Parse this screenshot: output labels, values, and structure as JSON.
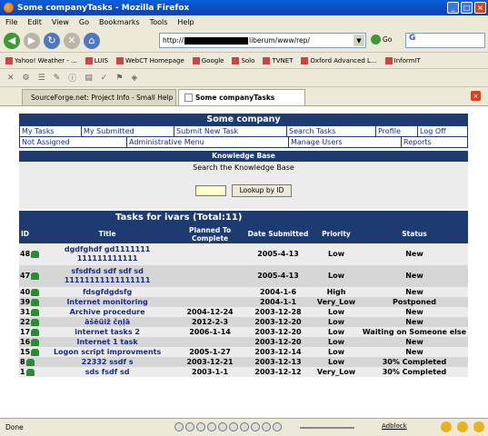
{
  "window": {
    "title": "Some companyTasks - Mozilla Firefox"
  },
  "menubar": [
    "File",
    "Edit",
    "View",
    "Go",
    "Bookmarks",
    "Tools",
    "Help"
  ],
  "navbar": {
    "url_prefix": "http://",
    "url_suffix": "liberum/www/rep/",
    "go_label": "Go",
    "search_value": "G"
  },
  "bookmarks": [
    "Yahoo! Weather - ...",
    "LUIS",
    "WebCT Homepage",
    "Google",
    "Solo",
    "TVNET",
    "Oxford Advanced L...",
    "InformIT"
  ],
  "tabs": [
    {
      "label": "SourceForge.net: Project Info - Small Help ..."
    },
    {
      "label": "Some companyTasks"
    }
  ],
  "app": {
    "company": "Some company",
    "menu_row1": [
      "My Tasks",
      "My Submitted",
      "Submit New Task",
      "Search Tasks",
      "Profile",
      "Log Off"
    ],
    "menu_row2": [
      "Not Assigned",
      "Administrative Menu",
      "Manage Users",
      "Reports"
    ],
    "kb_title": "Knowledge Base",
    "kb_label": "Search the Knowledge Base",
    "kb_input_value": "",
    "kb_button": "Lookup by ID",
    "tasks_title": "Tasks for ivars (Total:11)",
    "columns": [
      "ID",
      "Title",
      "Planned To Complete",
      "Date Submitted",
      "Priority",
      "Status"
    ],
    "rows": [
      {
        "id": "48",
        "title": "dgdfghdf gd1111111 111111111111",
        "planned": "",
        "submitted": "2005-4-13",
        "priority": "Low",
        "status": "New"
      },
      {
        "id": "47",
        "title": "sfsdfsd sdf sdf sd 11111111111111111",
        "planned": "",
        "submitted": "2005-4-13",
        "priority": "Low",
        "status": "New"
      },
      {
        "id": "40",
        "title": "fdsgfdgdsfg",
        "planned": "",
        "submitted": "2004-1-6",
        "priority": "High",
        "status": "New"
      },
      {
        "id": "39",
        "title": "Internet monitoring",
        "planned": "",
        "submitted": "2004-1-1",
        "priority": "Very_Low",
        "status": "Postponed"
      },
      {
        "id": "31",
        "title": "Archive procedure",
        "planned": "2004-12-24",
        "submitted": "2003-12-28",
        "priority": "Low",
        "status": "New"
      },
      {
        "id": "22",
        "title": "āšēūiž čņļā",
        "planned": "2012-2-3",
        "submitted": "2003-12-20",
        "priority": "Low",
        "status": "New"
      },
      {
        "id": "17",
        "title": "internet tasks 2",
        "planned": "2006-1-14",
        "submitted": "2003-12-20",
        "priority": "Low",
        "status": "Waiting on Someone else"
      },
      {
        "id": "16",
        "title": "Internet 1 task",
        "planned": "",
        "submitted": "2003-12-20",
        "priority": "Low",
        "status": "New"
      },
      {
        "id": "15",
        "title": "Logon script improvments",
        "planned": "2005-1-27",
        "submitted": "2003-12-14",
        "priority": "Low",
        "status": "New"
      },
      {
        "id": "8",
        "title": "22332 ssdf s",
        "planned": "2003-12-21",
        "submitted": "2003-12-13",
        "priority": "Low",
        "status": "30% Completed"
      },
      {
        "id": "1",
        "title": "sds fsdf sd",
        "planned": "2003-1-1",
        "submitted": "2003-12-12",
        "priority": "Very_Low",
        "status": "30% Completed"
      }
    ]
  },
  "status": {
    "text": "Done",
    "adblock": "Adblock"
  }
}
